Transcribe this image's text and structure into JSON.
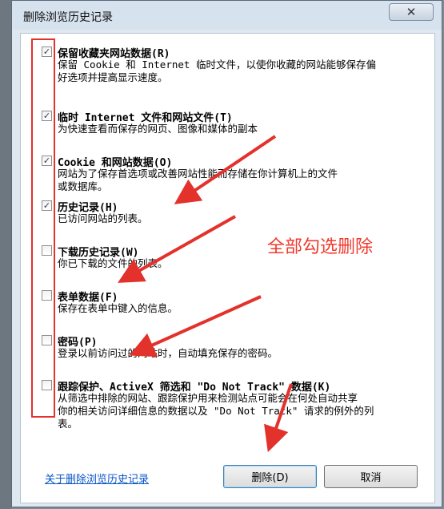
{
  "window": {
    "title": "删除浏览历史记录",
    "close_label": "✕"
  },
  "options": [
    {
      "label": "保留收藏夹网站数据(R)",
      "desc": "保留 Cookie 和 Internet 临时文件，以使你收藏的网站能够保存偏\n好选项并提高显示速度。",
      "checked": true
    },
    {
      "label": "临时 Internet 文件和网站文件(T)",
      "desc": "为快速查看而保存的网页、图像和媒体的副本",
      "checked": true
    },
    {
      "label": "Cookie 和网站数据(O)",
      "desc": "网站为了保存首选项或改善网站性能而存储在你计算机上的文件\n或数据库。",
      "checked": true
    },
    {
      "label": "历史记录(H)",
      "desc": "已访问网站的列表。",
      "checked": true
    },
    {
      "label": "下载历史记录(W)",
      "desc": "你已下载的文件的列表。",
      "checked": false
    },
    {
      "label": "表单数据(F)",
      "desc": "保存在表单中键入的信息。",
      "checked": false
    },
    {
      "label": "密码(P)",
      "desc": "登录以前访问过的网站时，自动填充保存的密码。",
      "checked": false
    },
    {
      "label": "跟踪保护、ActiveX 筛选和 \"Do Not Track\" 数据(K)",
      "desc": "从筛选中排除的网站、跟踪保护用来检测站点可能会在何处自动共享\n你的相关访问详细信息的数据以及 \"Do Not Track\" 请求的例外的列\n表。",
      "checked": false
    }
  ],
  "check_mark": "✓",
  "annotation": {
    "text": "全部勾选删除",
    "color": "#f03a2e"
  },
  "footer": {
    "link": "关于删除浏览历史记录",
    "delete_label": "删除(D)",
    "cancel_label": "取消"
  }
}
